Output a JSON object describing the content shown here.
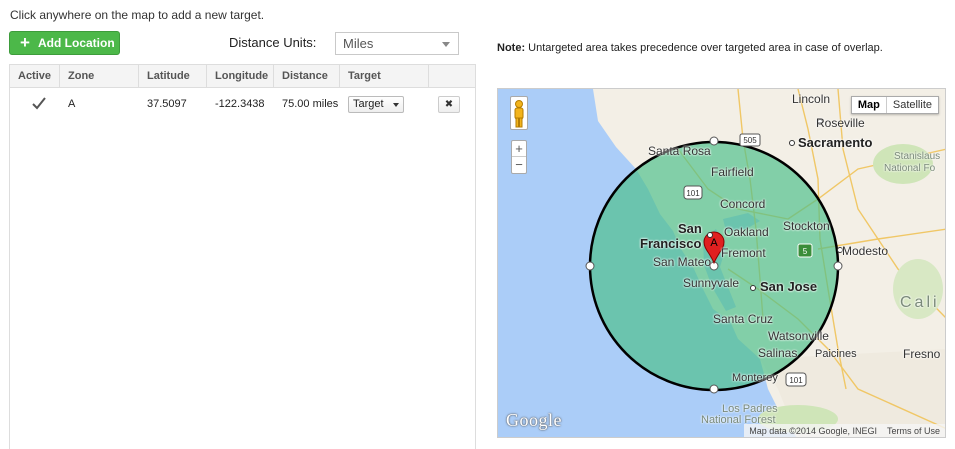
{
  "instruction": "Click anywhere on the map to add a new target.",
  "add_button": {
    "label": "Add Location",
    "icon": "plus-icon",
    "color": "#4cb849"
  },
  "distance_units": {
    "label": "Distance Units:",
    "selected": "Miles"
  },
  "table": {
    "columns": [
      "Active",
      "Zone",
      "Latitude",
      "Longitude",
      "Distance",
      "Target"
    ],
    "rows": [
      {
        "active": true,
        "zone": "A",
        "latitude": "37.5097",
        "longitude": "-122.3438",
        "distance": "75.00 miles",
        "target": "Target"
      }
    ]
  },
  "note": {
    "prefix": "Note:",
    "text": "Untargeted area takes precedence over targeted area in case of overlap."
  },
  "map": {
    "map_type_buttons": [
      "Map",
      "Satellite"
    ],
    "active_map_type": "Map",
    "zoom": {
      "in": "+",
      "out": "−"
    },
    "marker_label": "A",
    "circle_fill": "#4dc08a",
    "places": {
      "lincoln": "Lincoln",
      "roseville": "Roseville",
      "santa_rosa": "Santa Rosa",
      "sacramento": "Sacramento",
      "stanislaus": "Stanislaus",
      "national_fo": "National Fo",
      "fairfield": "Fairfield",
      "concord": "Concord",
      "stockton": "Stockton",
      "san": "San",
      "francisco": "Francisco",
      "oakland": "Oakland",
      "modesto": "Modesto",
      "san_mateo": "San Mateo",
      "fremont": "Fremont",
      "sunnyvale": "Sunnyvale",
      "san_jose": "San Jose",
      "cali": "Cali",
      "santa_cruz": "Santa Cruz",
      "watsonville": "Watsonville",
      "salinas": "Salinas",
      "paicines": "Paicines",
      "fresno": "Fresno",
      "monterey": "Monterey",
      "los_padres": "Los Padres",
      "national_forest": "National Forest"
    },
    "highway_shields": [
      "505",
      "101",
      "5",
      "101"
    ],
    "logo": "Google",
    "attribution": "Map data ©2014 Google, INEGI",
    "terms": "Terms of Use"
  }
}
